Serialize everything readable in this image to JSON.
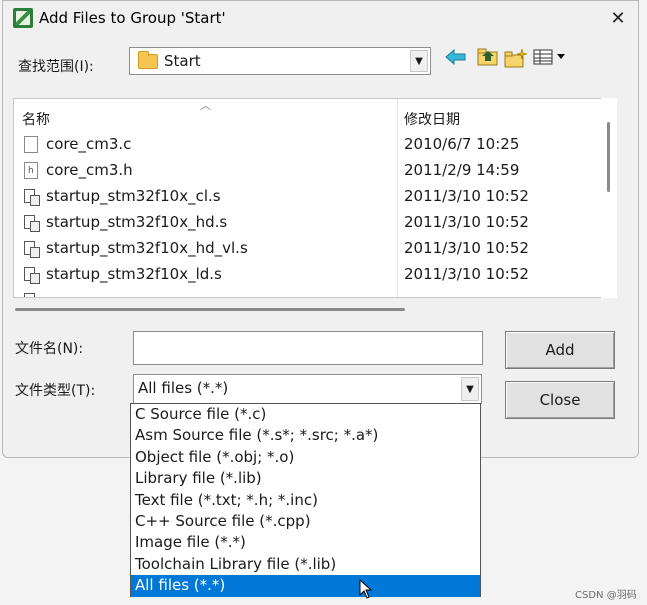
{
  "window": {
    "title": "Add Files to Group 'Start'",
    "close_glyph": "✕"
  },
  "lookin": {
    "label": "查找范围(I):",
    "value": "Start",
    "drop_glyph": "▼"
  },
  "toolbar": {
    "back_icon": "back-arrow-icon",
    "up_icon": "up-folder-icon",
    "newfolder_icon": "new-folder-icon",
    "views_icon": "view-menu-icon"
  },
  "filelist": {
    "col_name": "名称",
    "col_date": "修改日期",
    "rows": [
      {
        "name": "core_cm3.c",
        "date": "2010/6/7 10:25",
        "icon": "c-file-icon"
      },
      {
        "name": "core_cm3.h",
        "date": "2011/2/9 14:59",
        "icon": "h-file-icon"
      },
      {
        "name": "startup_stm32f10x_cl.s",
        "date": "2011/3/10 10:52",
        "icon": "asm-file-icon"
      },
      {
        "name": "startup_stm32f10x_hd.s",
        "date": "2011/3/10 10:52",
        "icon": "asm-file-icon"
      },
      {
        "name": "startup_stm32f10x_hd_vl.s",
        "date": "2011/3/10 10:52",
        "icon": "asm-file-icon"
      },
      {
        "name": "startup_stm32f10x_ld.s",
        "date": "2011/3/10 10:52",
        "icon": "asm-file-icon"
      }
    ]
  },
  "form": {
    "filename_label": "文件名(N):",
    "filename_value": "",
    "filetype_label": "文件类型(T):",
    "filetype_value": "All files (*.*)",
    "drop_glyph": "▼"
  },
  "buttons": {
    "add": "Add",
    "close": "Close"
  },
  "dropdown": {
    "options": [
      "C Source file (*.c)",
      "Asm Source file (*.s*; *.src; *.a*)",
      "Object file (*.obj; *.o)",
      "Library file (*.lib)",
      "Text file (*.txt; *.h; *.inc)",
      "C++ Source file (*.cpp)",
      "Image file (*.*)",
      "Toolchain Library file (*.lib)",
      "All files (*.*)"
    ],
    "selected_index": 8
  },
  "watermark": "CSDN @羽码"
}
